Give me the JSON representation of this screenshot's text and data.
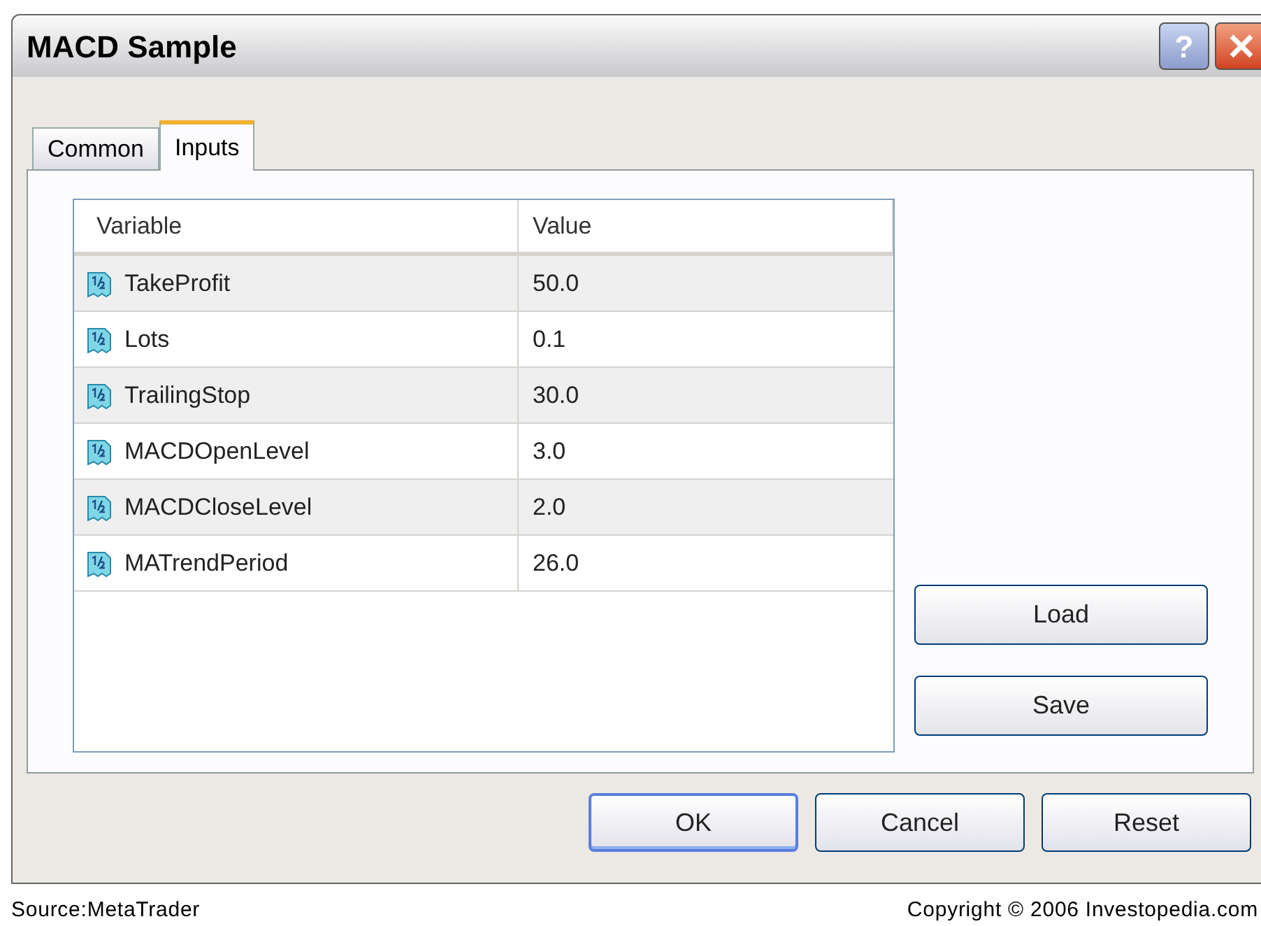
{
  "window": {
    "title": "MACD Sample",
    "help_button": "?"
  },
  "tabs": [
    {
      "label": "Common",
      "selected": false
    },
    {
      "label": "Inputs",
      "selected": true
    }
  ],
  "table": {
    "columns": [
      "Variable",
      "Value"
    ],
    "rows": [
      {
        "variable": "TakeProfit",
        "value": "50.0"
      },
      {
        "variable": "Lots",
        "value": "0.1"
      },
      {
        "variable": "TrailingStop",
        "value": "30.0"
      },
      {
        "variable": "MACDOpenLevel",
        "value": "3.0"
      },
      {
        "variable": "MACDCloseLevel",
        "value": "2.0"
      },
      {
        "variable": "MATrendPeriod",
        "value": "26.0"
      }
    ]
  },
  "side_buttons": [
    "Load",
    "Save"
  ],
  "buttons": [
    {
      "label": "OK",
      "default": true
    },
    {
      "label": "Cancel",
      "default": false
    },
    {
      "label": "Reset",
      "default": false
    }
  ],
  "caption": {
    "source": "Source:MetaTrader",
    "copyright": "Copyright © 2006 Investopedia.com"
  }
}
